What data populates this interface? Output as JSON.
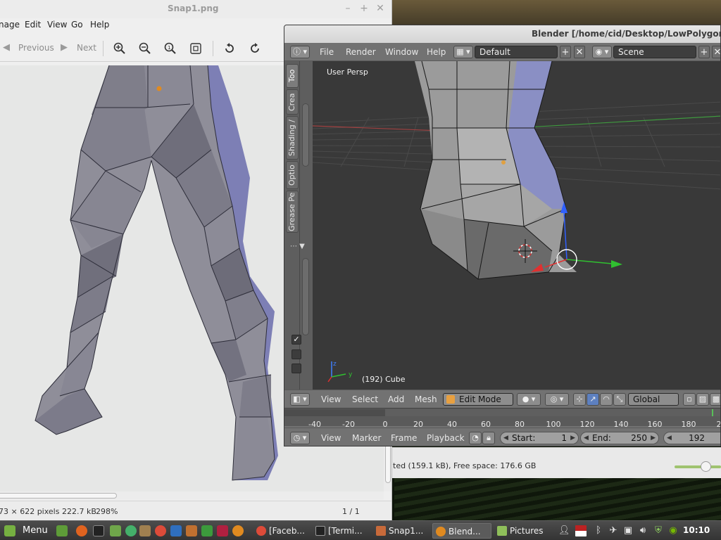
{
  "viewer": {
    "title": "Snap1.png",
    "menu": [
      "nage",
      "Edit",
      "View",
      "Go",
      "Help"
    ],
    "toolbar": {
      "previous": "Previous",
      "next": "Next"
    },
    "status": {
      "info": "73 × 622 pixels  222.7 kB",
      "zoom": "298%",
      "position": "1 / 1"
    },
    "window_buttons": {
      "minimize": "–",
      "maximize": "+",
      "close": "✕"
    }
  },
  "file_manager": {
    "status": "ted (159.1 kB), Free space: 176.6 GB",
    "zoom_level": 0.72
  },
  "blender": {
    "title": "Blender [/home/cid/Desktop/LowPolygonMar",
    "menu": [
      "File",
      "Render",
      "Window",
      "Help"
    ],
    "layout": "Default",
    "scene": "Scene",
    "tabs": [
      "Too",
      "Crea",
      "Shading /",
      "Optio",
      "Grease Pe"
    ],
    "viewport": {
      "view_label": "User Persp",
      "object_label": "(192) Cube"
    },
    "view3d_header": {
      "menu": [
        "View",
        "Select",
        "Add",
        "Mesh"
      ],
      "mode": "Edit Mode",
      "orientation": "Global"
    },
    "timeline": {
      "ticks": [
        "-40",
        "-20",
        "0",
        "20",
        "40",
        "60",
        "80",
        "100",
        "120",
        "140",
        "160",
        "180",
        "2"
      ],
      "menu": [
        "View",
        "Marker",
        "Frame",
        "Playback"
      ],
      "start_label": "Start:",
      "start_value": "1",
      "end_label": "End:",
      "end_value": "250",
      "current_frame": "192"
    }
  },
  "taskbar": {
    "menu_label": "Menu",
    "tasks": [
      "[Faceb...",
      "[Termi...",
      "Snap1...",
      "Blend...",
      "Pictures"
    ],
    "clock": "10:10"
  },
  "colors": {
    "mesh_front": "#8f8e99",
    "mesh_side": "#7d7fb5",
    "blender_bg": "#393939",
    "accent_green": "#76b041"
  }
}
